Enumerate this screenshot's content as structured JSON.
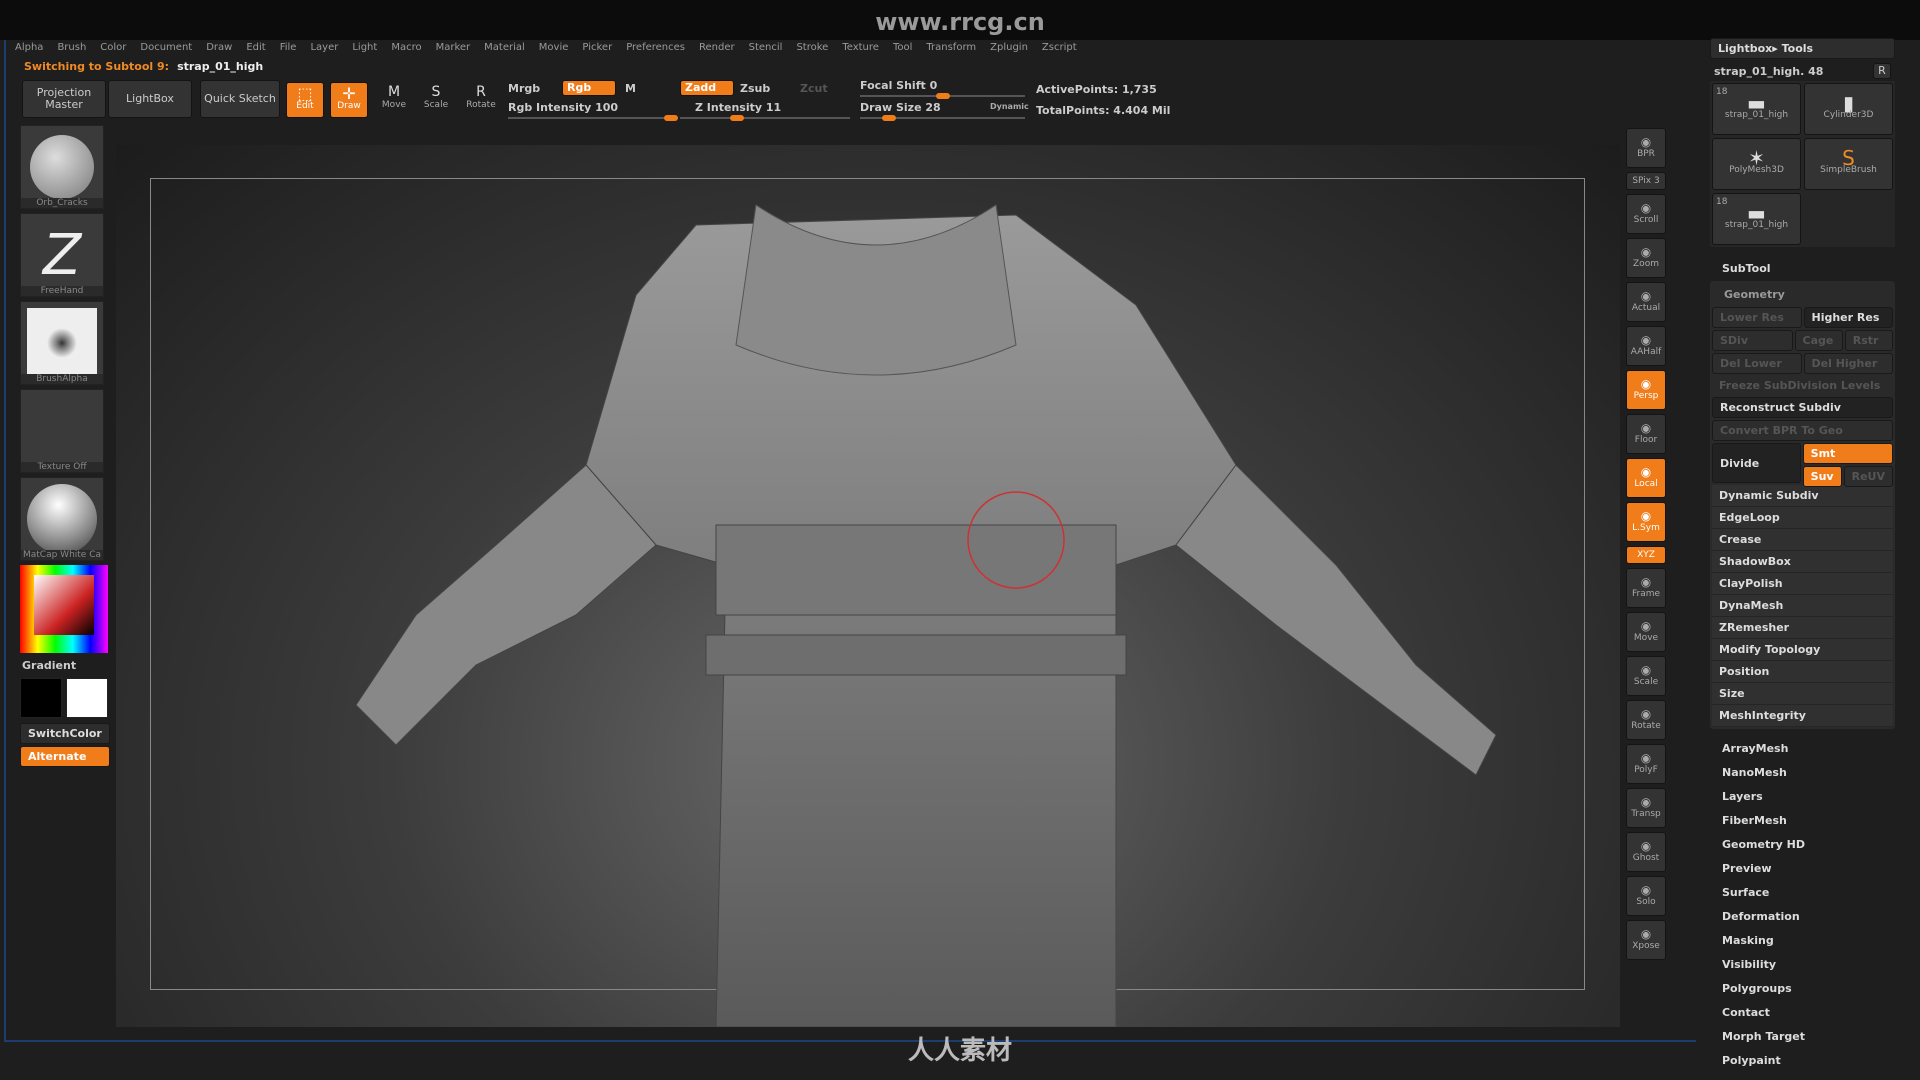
{
  "watermark": {
    "url": "www.rrcg.cn",
    "logo": "人人素材"
  },
  "menu": [
    "Alpha",
    "Brush",
    "Color",
    "Document",
    "Draw",
    "Edit",
    "File",
    "Layer",
    "Light",
    "Macro",
    "Marker",
    "Material",
    "Movie",
    "Picker",
    "Preferences",
    "Render",
    "Stencil",
    "Stroke",
    "Texture",
    "Tool",
    "Transform",
    "Zplugin",
    "Zscript"
  ],
  "status": {
    "prefix": "Switching to Subtool 9:",
    "name": "strap_01_high"
  },
  "toolbar": {
    "projection_master": "Projection Master",
    "lightbox": "LightBox",
    "quick_sketch": "Quick Sketch",
    "edit": "Edit",
    "draw": "Draw",
    "move": "Move",
    "scale": "Scale",
    "rotate": "Rotate",
    "mrgb": "Mrgb",
    "rgb": "Rgb",
    "m": "M",
    "rgb_intensity": "Rgb Intensity 100",
    "rgb_intensity_value": 100,
    "zadd": "Zadd",
    "zsub": "Zsub",
    "zcut": "Zcut",
    "z_intensity": "Z Intensity 11",
    "z_intensity_value": 11,
    "focal_shift": "Focal Shift 0",
    "draw_size": "Draw Size 28",
    "dynamic": "Dynamic",
    "active_points": "ActivePoints: 1,735",
    "total_points": "TotalPoints: 4.404 Mil"
  },
  "left": {
    "brush": "Orb_Cracks",
    "stroke": "FreeHand",
    "alpha": "BrushAlpha",
    "texture": "Texture Off",
    "material": "MatCap White Ca",
    "gradient": "Gradient",
    "switch_color": "SwitchColor",
    "alternate": "Alternate"
  },
  "right_toolbar": [
    {
      "label": "BPR"
    },
    {
      "label": "SPix 3"
    },
    {
      "label": "Scroll"
    },
    {
      "label": "Zoom"
    },
    {
      "label": "Actual"
    },
    {
      "label": "AAHalf"
    },
    {
      "label": "Persp",
      "active": true
    },
    {
      "label": "Floor"
    },
    {
      "label": "Local",
      "active": true
    },
    {
      "label": "L.Sym",
      "active": true
    },
    {
      "label": "XYZ",
      "active": true
    },
    {
      "label": "Frame"
    },
    {
      "label": "Move"
    },
    {
      "label": "Scale"
    },
    {
      "label": "Rotate"
    },
    {
      "label": "PolyF"
    },
    {
      "label": "Transp"
    },
    {
      "label": "Ghost"
    },
    {
      "label": "Solo"
    },
    {
      "label": "Xpose"
    }
  ],
  "tool_panel": {
    "header": "Lightbox▸ Tools",
    "current": "strap_01_high. 48",
    "r": "R",
    "tools": [
      {
        "name": "strap_01_high",
        "count": "18"
      },
      {
        "name": "Cylinder3D"
      },
      {
        "name": "PolyMesh3D"
      },
      {
        "name": "SimpleBrush"
      },
      {
        "name": "strap_01_high",
        "count": "18"
      }
    ],
    "subtool": "SubTool",
    "geometry": "Geometry",
    "geo": {
      "lower_res": "Lower Res",
      "higher_res": "Higher Res",
      "sdiv": "SDiv",
      "cage": "Cage",
      "rstr": "Rstr",
      "del_lower": "Del Lower",
      "del_higher": "Del Higher",
      "freeze": "Freeze SubDivision Levels",
      "reconstruct": "Reconstruct Subdiv",
      "convert": "Convert BPR To Geo",
      "divide": "Divide",
      "smt": "Smt",
      "suv": "Suv",
      "reuv": "ReUV"
    },
    "geo_items": [
      "Dynamic Subdiv",
      "EdgeLoop",
      "Crease",
      "ShadowBox",
      "ClayPolish",
      "DynaMesh",
      "ZRemesher",
      "Modify Topology",
      "Position",
      "Size",
      "MeshIntegrity"
    ],
    "sections": [
      "ArrayMesh",
      "NanoMesh",
      "Layers",
      "FiberMesh",
      "Geometry HD",
      "Preview",
      "Surface",
      "Deformation",
      "Masking",
      "Visibility",
      "Polygroups",
      "Contact",
      "Morph Target",
      "Polypaint"
    ]
  },
  "colors": {
    "accent": "#f07c1a",
    "primary_color": "#000000",
    "secondary_color": "#ffffff"
  }
}
